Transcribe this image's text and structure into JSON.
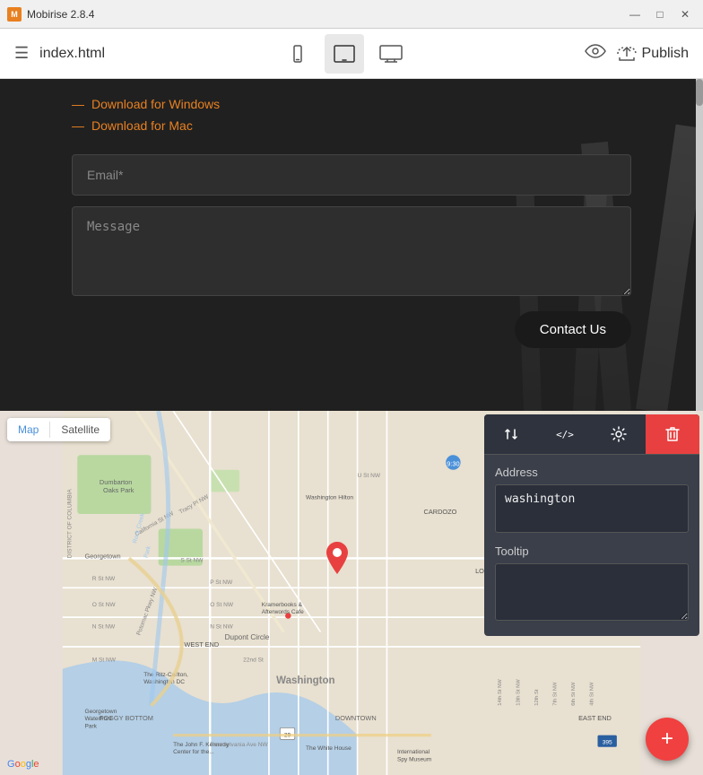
{
  "titleBar": {
    "appName": "Mobirise 2.8.4",
    "minimizeLabel": "—",
    "maximizeLabel": "□",
    "closeLabel": "✕"
  },
  "toolbar": {
    "fileName": "index.html",
    "deviceButtons": [
      {
        "id": "mobile",
        "icon": "📱",
        "label": "Mobile view"
      },
      {
        "id": "tablet",
        "icon": "⬜",
        "label": "Tablet view",
        "active": true
      },
      {
        "id": "desktop",
        "icon": "🖥",
        "label": "Desktop view"
      }
    ],
    "previewIcon": "👁",
    "publishIcon": "☁",
    "publishLabel": "Publish"
  },
  "formSection": {
    "downloadLinks": [
      {
        "text": "Download for Windows"
      },
      {
        "text": "Download for Mac"
      }
    ],
    "emailPlaceholder": "Email*",
    "messagePlaceholder": "Message",
    "contactButtonLabel": "Contact Us"
  },
  "mapSection": {
    "tabs": [
      {
        "id": "map",
        "label": "Map",
        "active": true
      },
      {
        "id": "satellite",
        "label": "Satellite"
      }
    ],
    "googleLabel": "Google"
  },
  "propertiesPanel": {
    "tools": [
      {
        "id": "transfer",
        "icon": "⇅",
        "active": false
      },
      {
        "id": "code",
        "icon": "</>",
        "active": false
      },
      {
        "id": "settings",
        "icon": "⚙",
        "active": false
      },
      {
        "id": "delete",
        "icon": "🗑",
        "danger": true
      }
    ],
    "addressLabel": "Address",
    "addressValue": "washington",
    "tooltipLabel": "Tooltip",
    "tooltipValue": ""
  },
  "fab": {
    "icon": "+"
  }
}
